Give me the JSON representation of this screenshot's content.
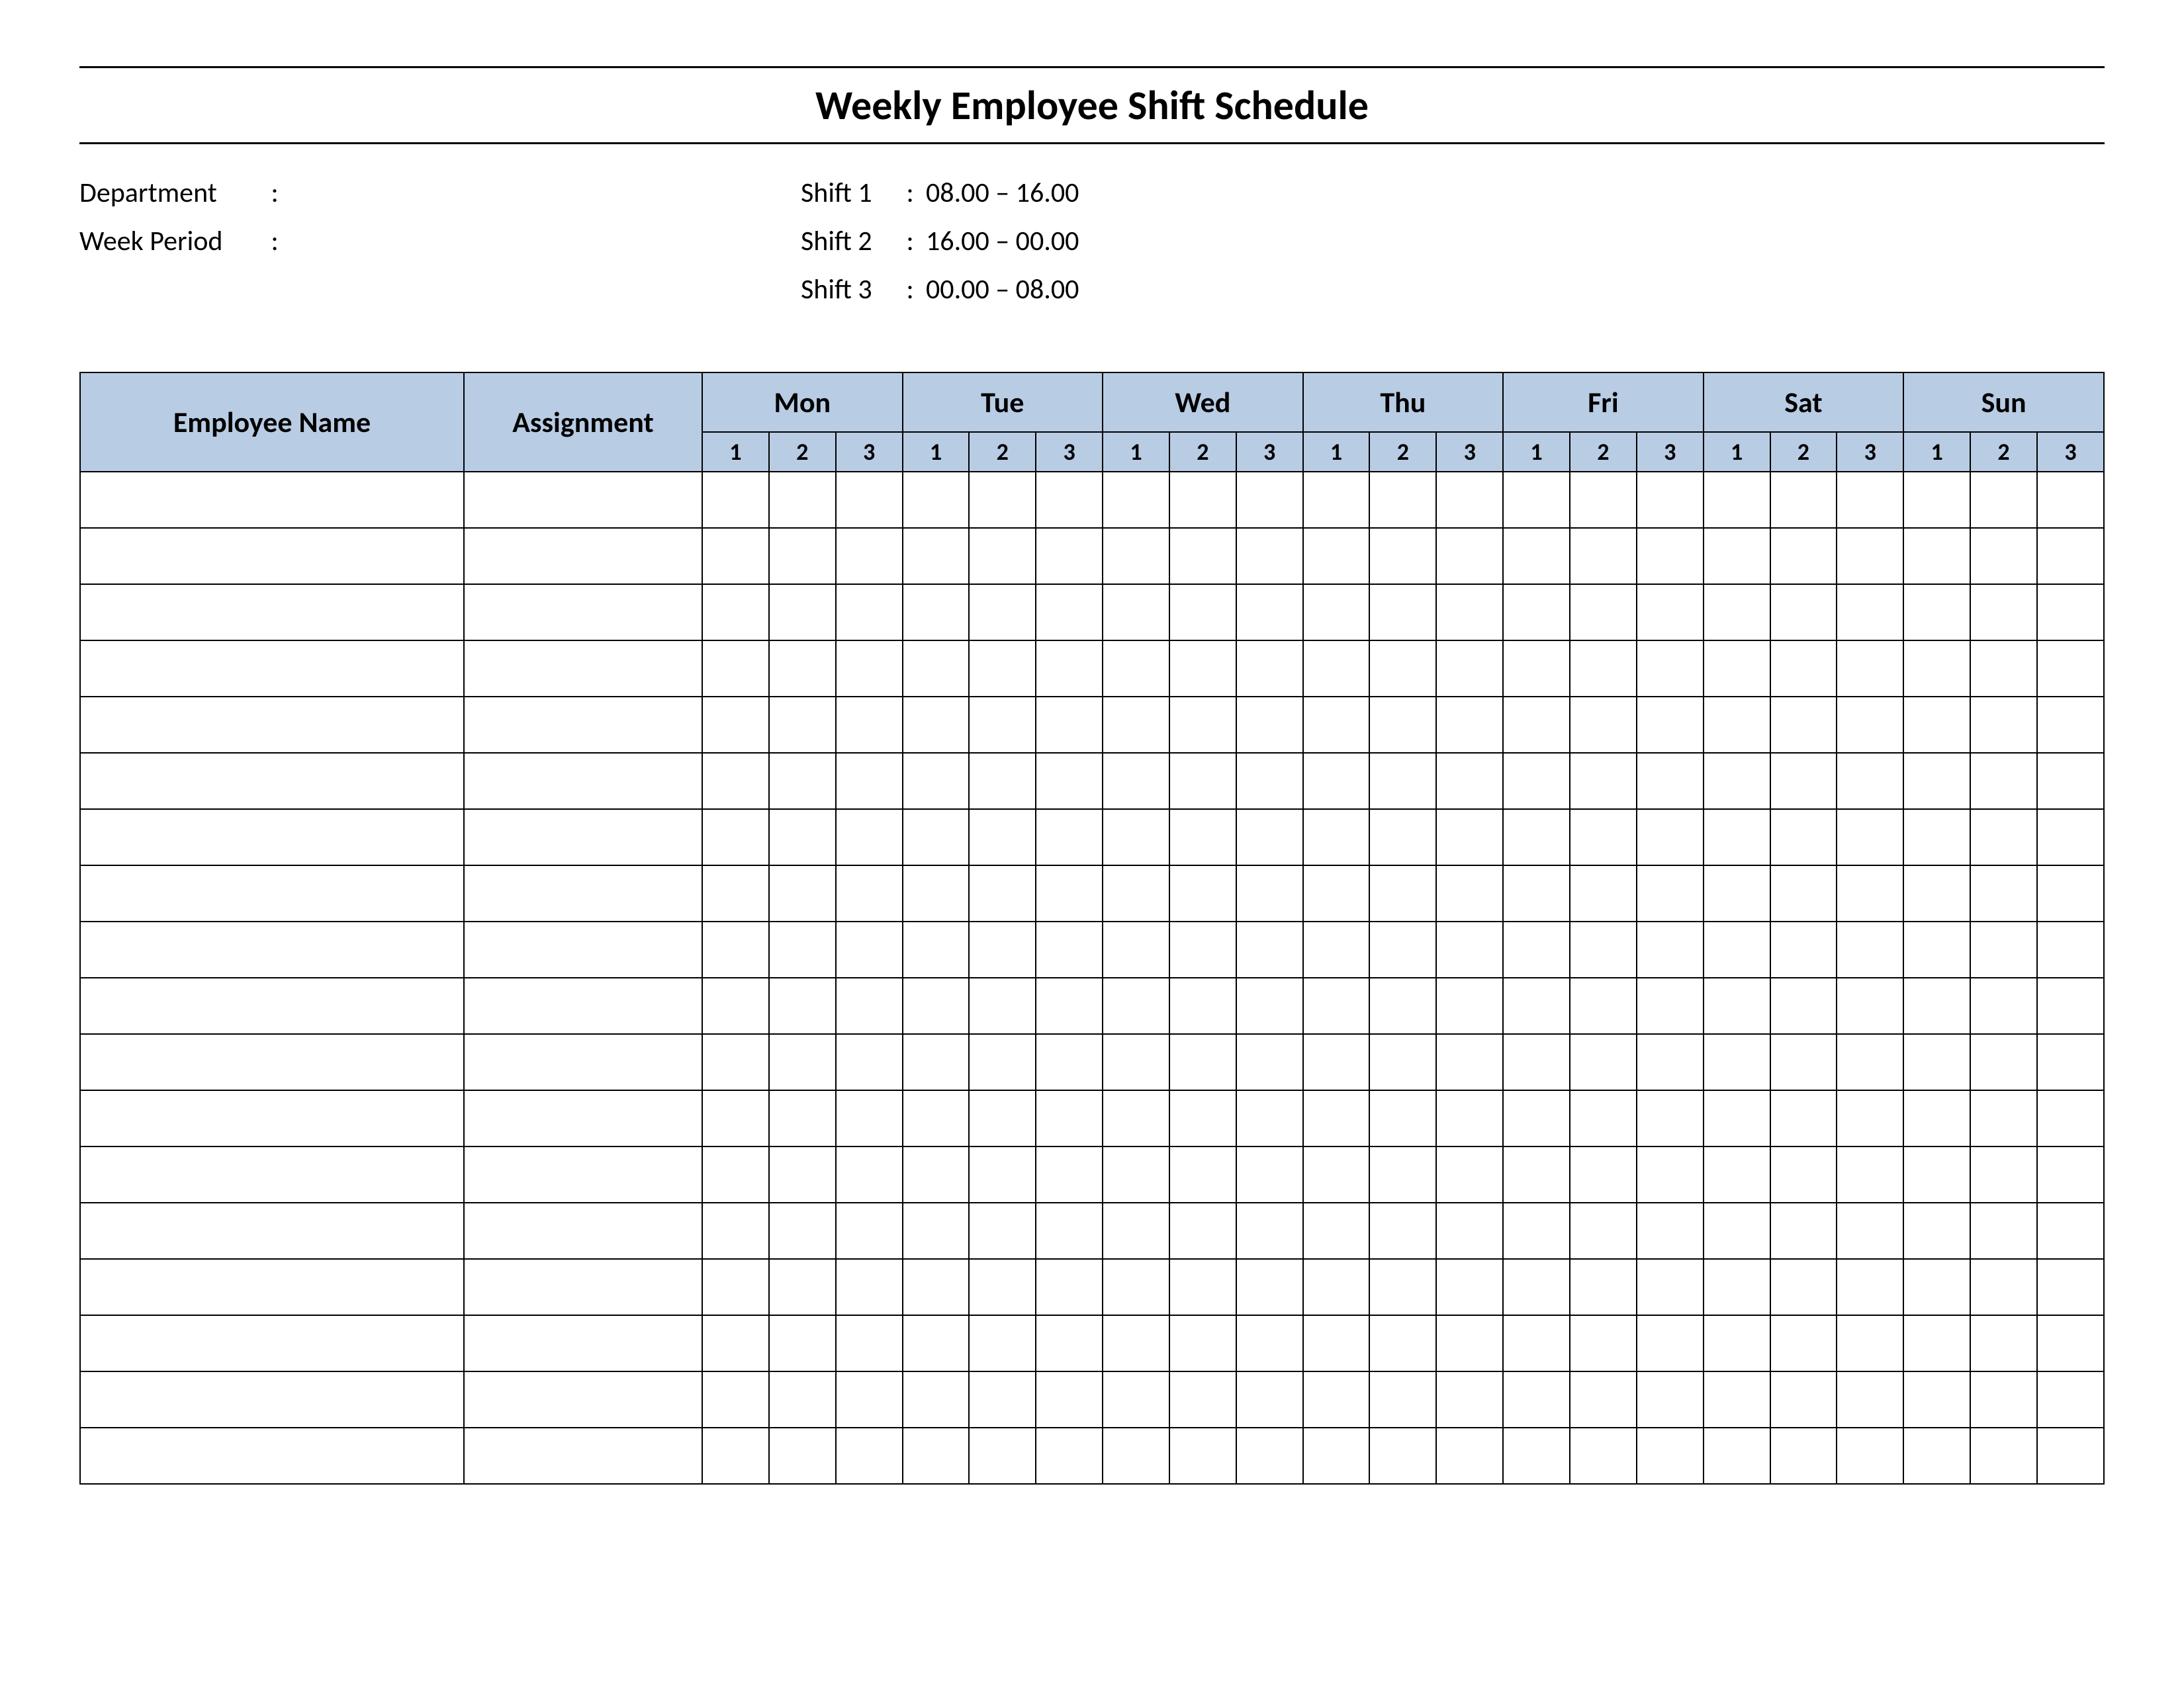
{
  "title": "Weekly Employee Shift Schedule",
  "info": {
    "department_label": "Department",
    "department_value": "",
    "week_period_label": "Week  Period",
    "week_period_value": ""
  },
  "shifts": [
    {
      "label": "Shift 1",
      "time": "08.00  – 16.00"
    },
    {
      "label": "Shift 2",
      "time": "16.00  – 00.00"
    },
    {
      "label": "Shift 3",
      "time": "00.00  – 08.00"
    }
  ],
  "table": {
    "headers": {
      "employee_name": "Employee Name",
      "assignment": "Assignment",
      "days": [
        "Mon",
        "Tue",
        "Wed",
        "Thu",
        "Fri",
        "Sat",
        "Sun"
      ],
      "sub": [
        "1",
        "2",
        "3"
      ]
    },
    "rows": [
      {
        "name": "",
        "assignment": "",
        "cells": [
          "",
          "",
          "",
          "",
          "",
          "",
          "",
          "",
          "",
          "",
          "",
          "",
          "",
          "",
          "",
          "",
          "",
          "",
          "",
          "",
          ""
        ]
      },
      {
        "name": "",
        "assignment": "",
        "cells": [
          "",
          "",
          "",
          "",
          "",
          "",
          "",
          "",
          "",
          "",
          "",
          "",
          "",
          "",
          "",
          "",
          "",
          "",
          "",
          "",
          ""
        ]
      },
      {
        "name": "",
        "assignment": "",
        "cells": [
          "",
          "",
          "",
          "",
          "",
          "",
          "",
          "",
          "",
          "",
          "",
          "",
          "",
          "",
          "",
          "",
          "",
          "",
          "",
          "",
          ""
        ]
      },
      {
        "name": "",
        "assignment": "",
        "cells": [
          "",
          "",
          "",
          "",
          "",
          "",
          "",
          "",
          "",
          "",
          "",
          "",
          "",
          "",
          "",
          "",
          "",
          "",
          "",
          "",
          ""
        ]
      },
      {
        "name": "",
        "assignment": "",
        "cells": [
          "",
          "",
          "",
          "",
          "",
          "",
          "",
          "",
          "",
          "",
          "",
          "",
          "",
          "",
          "",
          "",
          "",
          "",
          "",
          "",
          ""
        ]
      },
      {
        "name": "",
        "assignment": "",
        "cells": [
          "",
          "",
          "",
          "",
          "",
          "",
          "",
          "",
          "",
          "",
          "",
          "",
          "",
          "",
          "",
          "",
          "",
          "",
          "",
          "",
          ""
        ]
      },
      {
        "name": "",
        "assignment": "",
        "cells": [
          "",
          "",
          "",
          "",
          "",
          "",
          "",
          "",
          "",
          "",
          "",
          "",
          "",
          "",
          "",
          "",
          "",
          "",
          "",
          "",
          ""
        ]
      },
      {
        "name": "",
        "assignment": "",
        "cells": [
          "",
          "",
          "",
          "",
          "",
          "",
          "",
          "",
          "",
          "",
          "",
          "",
          "",
          "",
          "",
          "",
          "",
          "",
          "",
          "",
          ""
        ]
      },
      {
        "name": "",
        "assignment": "",
        "cells": [
          "",
          "",
          "",
          "",
          "",
          "",
          "",
          "",
          "",
          "",
          "",
          "",
          "",
          "",
          "",
          "",
          "",
          "",
          "",
          "",
          ""
        ]
      },
      {
        "name": "",
        "assignment": "",
        "cells": [
          "",
          "",
          "",
          "",
          "",
          "",
          "",
          "",
          "",
          "",
          "",
          "",
          "",
          "",
          "",
          "",
          "",
          "",
          "",
          "",
          ""
        ]
      },
      {
        "name": "",
        "assignment": "",
        "cells": [
          "",
          "",
          "",
          "",
          "",
          "",
          "",
          "",
          "",
          "",
          "",
          "",
          "",
          "",
          "",
          "",
          "",
          "",
          "",
          "",
          ""
        ]
      },
      {
        "name": "",
        "assignment": "",
        "cells": [
          "",
          "",
          "",
          "",
          "",
          "",
          "",
          "",
          "",
          "",
          "",
          "",
          "",
          "",
          "",
          "",
          "",
          "",
          "",
          "",
          ""
        ]
      },
      {
        "name": "",
        "assignment": "",
        "cells": [
          "",
          "",
          "",
          "",
          "",
          "",
          "",
          "",
          "",
          "",
          "",
          "",
          "",
          "",
          "",
          "",
          "",
          "",
          "",
          "",
          ""
        ]
      },
      {
        "name": "",
        "assignment": "",
        "cells": [
          "",
          "",
          "",
          "",
          "",
          "",
          "",
          "",
          "",
          "",
          "",
          "",
          "",
          "",
          "",
          "",
          "",
          "",
          "",
          "",
          ""
        ]
      },
      {
        "name": "",
        "assignment": "",
        "cells": [
          "",
          "",
          "",
          "",
          "",
          "",
          "",
          "",
          "",
          "",
          "",
          "",
          "",
          "",
          "",
          "",
          "",
          "",
          "",
          "",
          ""
        ]
      },
      {
        "name": "",
        "assignment": "",
        "cells": [
          "",
          "",
          "",
          "",
          "",
          "",
          "",
          "",
          "",
          "",
          "",
          "",
          "",
          "",
          "",
          "",
          "",
          "",
          "",
          "",
          ""
        ]
      },
      {
        "name": "",
        "assignment": "",
        "cells": [
          "",
          "",
          "",
          "",
          "",
          "",
          "",
          "",
          "",
          "",
          "",
          "",
          "",
          "",
          "",
          "",
          "",
          "",
          "",
          "",
          ""
        ]
      },
      {
        "name": "",
        "assignment": "",
        "cells": [
          "",
          "",
          "",
          "",
          "",
          "",
          "",
          "",
          "",
          "",
          "",
          "",
          "",
          "",
          "",
          "",
          "",
          "",
          "",
          "",
          ""
        ]
      }
    ]
  }
}
